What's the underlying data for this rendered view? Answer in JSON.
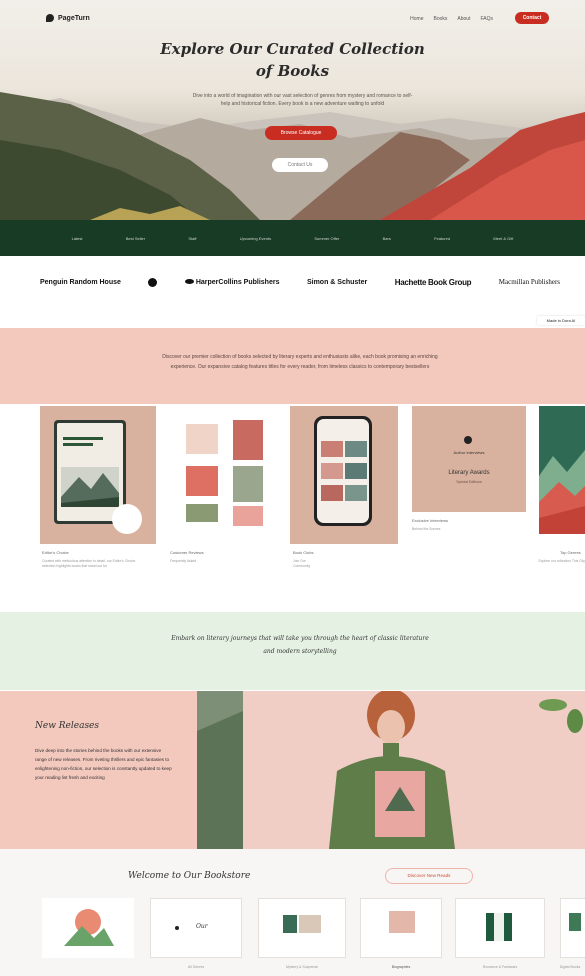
{
  "brand": {
    "name": "PageTurn",
    "accent": "#c92c21",
    "dark_green": "#173b24",
    "pink": "#f3c8bd",
    "mint": "#e5f2e3"
  },
  "nav": {
    "links": [
      "Home",
      "Books",
      "About",
      "FAQs"
    ],
    "contact_label": "Contact"
  },
  "hero": {
    "title": "Explore Our Curated Collection of Books",
    "subtitle": "Dive into a world of imagination with our vast selection of genres from mystery and romance to self-help and historical fiction. Every book is a new adventure waiting to unfold",
    "primary_button": "Browse Catalogue",
    "secondary_button": "Contact Us"
  },
  "categories": [
    "Latest",
    "Best Seller",
    "Staff",
    "Upcoming Events",
    "Summer Offer",
    "Bars",
    "Featured",
    "Meet & Gift"
  ],
  "publishers": [
    "Penguin Random House",
    "HarperCollins Publishers",
    "Simon & Schuster",
    "Hachette Book Group",
    "Macmillan Publishers"
  ],
  "made_badge": "Made in Dora AI",
  "intro_text": "Discover our premier collection of books selected by literary experts and enthusiasts alike, each book promising an enriching experience. Our expansive catalog features titles for every reader, from timeless classics to contemporary bestsellers",
  "cards": [
    {
      "title": "Editor's Choice",
      "text": "Curated with meticulous attention to detail, our Editor's Choice selection highlights books that stand out for"
    },
    {
      "title": "Customer Reviews",
      "text": "Frequently Asked"
    },
    {
      "title": "Book Clubs",
      "text": "Join Our Community"
    },
    {
      "title": "Exclusive Interviews",
      "text": "Behind the Scenes",
      "tile_top": "Author Interviews",
      "tile_main": "Literary Awards",
      "tile_sub": "Special Editions"
    },
    {
      "title": "Top Genres",
      "text": "Explore our collection This City"
    }
  ],
  "quote": "Embark on literary journeys that will take you through the heart of classic literature and modern storytelling",
  "releases": {
    "title": "New Releases",
    "text": "Dive deep into the stories behind the books with our extensive range of new releases. From riveting thrillers and epic fantasies to enlightening non-fiction, our selection is constantly updated to keep your reading list fresh and exciting"
  },
  "welcome": {
    "title": "Welcome to Our Bookstore",
    "button": "Discover New Reads",
    "tile_text": "Our",
    "tiles": [
      "",
      "All Genres",
      "Mystery & Suspense",
      "Biographies",
      "Romance & Fantasies",
      "Digital Books"
    ]
  }
}
